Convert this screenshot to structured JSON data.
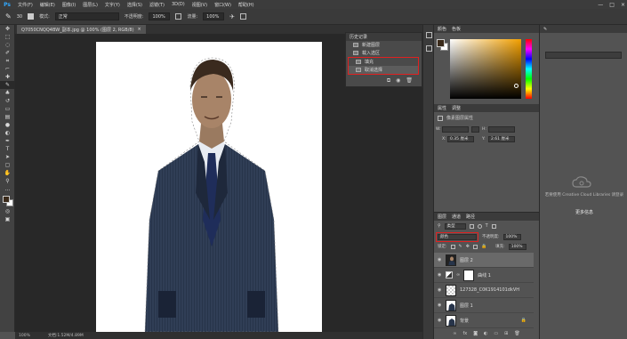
{
  "app": {
    "logo": "Ps",
    "menu": [
      "文件(F)",
      "编辑(E)",
      "图像(I)",
      "图层(L)",
      "文字(Y)",
      "选择(S)",
      "滤镜(T)",
      "3D(D)",
      "视图(V)",
      "窗口(W)",
      "帮助(H)"
    ],
    "window_controls": [
      "—",
      "□",
      "×"
    ]
  },
  "options": {
    "brush_size": "30",
    "mode_label": "模式:",
    "mode_value": "正常",
    "opacity_label": "不透明度:",
    "opacity_value": "100%",
    "flow_label": "流量:",
    "flow_value": "100%"
  },
  "document": {
    "tab_title": "Q7050CNQQ4BW_副本.jpg @ 100% (图层 2, RGB/8)",
    "tab_close": "×"
  },
  "status": {
    "zoom": "100%",
    "doc_info": "文档:1.52M/4.89M"
  },
  "history_panel": {
    "title": "历史记录",
    "items": [
      "新建图层",
      "载入选区",
      "填充",
      "取消选择"
    ],
    "highlighted": [
      "填充",
      "取消选择"
    ]
  },
  "color_panel": {
    "tabs": [
      "颜色",
      "色板"
    ],
    "foreground": "#3a2a1a",
    "background": "#ffffff",
    "field_hue": "#f3a000"
  },
  "properties_panel": {
    "tabs": [
      "属性",
      "调整"
    ],
    "title": "像素图层属性",
    "w_label": "W:",
    "h_label": "H:",
    "link_label": "GD",
    "x_label": "X:",
    "x_value": "0.35 厘米",
    "y_label": "Y:",
    "y_value": "2.61 厘米"
  },
  "layers_panel": {
    "tabs": [
      "图层",
      "通道",
      "路径"
    ],
    "filter_label": "类型",
    "blend_mode": "颜色",
    "opacity_label": "不透明度:",
    "opacity_value": "100%",
    "lock_label": "锁定:",
    "fill_label": "填充:",
    "fill_value": "100%",
    "layers": [
      {
        "name": "图层 2",
        "selected": true
      },
      {
        "name": "曲线 1",
        "selected": false
      },
      {
        "name": "127328_C0K1914101dkVH",
        "selected": false
      },
      {
        "name": "图层 1",
        "selected": false
      },
      {
        "name": "背景",
        "selected": false
      }
    ]
  },
  "libraries_panel": {
    "message": "若要使用 Creative Cloud Libraries 请登录",
    "link": "更多信息"
  },
  "colors": {
    "accent_red": "#e02020",
    "ps_blue": "#31a8ff"
  }
}
